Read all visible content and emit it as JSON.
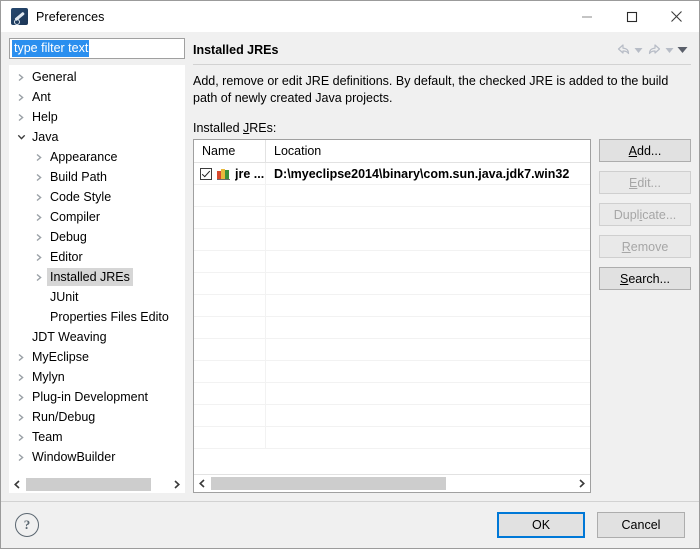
{
  "window": {
    "title": "Preferences",
    "icon": "preferences-wrench-icon",
    "minimize_label": "—",
    "maximize_label": "□",
    "close_label": "✕"
  },
  "filter": {
    "value": "type filter text",
    "placeholder": "type filter text"
  },
  "tree": {
    "items": [
      {
        "label": "General",
        "level": 0,
        "arrow": "collapsed",
        "selected": false
      },
      {
        "label": "Ant",
        "level": 0,
        "arrow": "collapsed",
        "selected": false
      },
      {
        "label": "Help",
        "level": 0,
        "arrow": "collapsed",
        "selected": false
      },
      {
        "label": "Java",
        "level": 0,
        "arrow": "expanded",
        "selected": false
      },
      {
        "label": "Appearance",
        "level": 1,
        "arrow": "collapsed",
        "selected": false
      },
      {
        "label": "Build Path",
        "level": 1,
        "arrow": "collapsed",
        "selected": false
      },
      {
        "label": "Code Style",
        "level": 1,
        "arrow": "collapsed",
        "selected": false
      },
      {
        "label": "Compiler",
        "level": 1,
        "arrow": "collapsed",
        "selected": false
      },
      {
        "label": "Debug",
        "level": 1,
        "arrow": "collapsed",
        "selected": false
      },
      {
        "label": "Editor",
        "level": 1,
        "arrow": "collapsed",
        "selected": false
      },
      {
        "label": "Installed JREs",
        "level": 1,
        "arrow": "collapsed",
        "selected": true
      },
      {
        "label": "JUnit",
        "level": 1,
        "arrow": "none",
        "selected": false
      },
      {
        "label": "Properties Files Edito",
        "level": 1,
        "arrow": "none",
        "selected": false
      },
      {
        "label": "JDT Weaving",
        "level": 0,
        "arrow": "none",
        "selected": false
      },
      {
        "label": "MyEclipse",
        "level": 0,
        "arrow": "collapsed",
        "selected": false
      },
      {
        "label": "Mylyn",
        "level": 0,
        "arrow": "collapsed",
        "selected": false
      },
      {
        "label": "Plug-in Development",
        "level": 0,
        "arrow": "collapsed",
        "selected": false
      },
      {
        "label": "Run/Debug",
        "level": 0,
        "arrow": "collapsed",
        "selected": false
      },
      {
        "label": "Team",
        "level": 0,
        "arrow": "collapsed",
        "selected": false
      },
      {
        "label": "WindowBuilder",
        "level": 0,
        "arrow": "collapsed",
        "selected": false
      }
    ]
  },
  "page": {
    "title": "Installed JREs",
    "description": "Add, remove or edit JRE definitions. By default, the checked JRE is added to the build path of newly created Java projects.",
    "list_label_pre": "Installed ",
    "list_label_mnemonic": "J",
    "list_label_post": "REs:",
    "header_tools": [
      {
        "name": "back-arrow-icon",
        "state": "disabled"
      },
      {
        "name": "back-dropdown-icon",
        "state": "disabled"
      },
      {
        "name": "forward-arrow-icon",
        "state": "disabled"
      },
      {
        "name": "forward-dropdown-icon",
        "state": "disabled"
      },
      {
        "name": "view-menu-dropdown-icon",
        "state": "enabled"
      }
    ]
  },
  "table": {
    "columns": [
      {
        "key": "name",
        "header": "Name"
      },
      {
        "key": "location",
        "header": "Location"
      }
    ],
    "rows": [
      {
        "checked": true,
        "icon": "jre-library-icon",
        "name": "jre ...",
        "location": "D:\\myeclipse2014\\binary\\com.sun.java.jdk7.win32"
      }
    ],
    "empty_row_count": 12
  },
  "side_buttons": [
    {
      "label": "Add...",
      "mnemonic": "A",
      "enabled": true
    },
    {
      "label": "Edit...",
      "mnemonic": "E",
      "enabled": false
    },
    {
      "label": "Duplicate...",
      "mnemonic": "i",
      "enabled": false
    },
    {
      "label": "Remove",
      "mnemonic": "R",
      "enabled": false
    },
    {
      "label": "Search...",
      "mnemonic": "S",
      "enabled": true
    }
  ],
  "scrollbars": {
    "tree": {
      "left_arrow": "‹",
      "right_arrow": "›",
      "thumb_percent": 88
    },
    "table": {
      "left_arrow": "‹",
      "right_arrow": "›",
      "thumb_percent": 65
    }
  },
  "footer": {
    "help_label": "?",
    "ok_label": "OK",
    "cancel_label": "Cancel"
  },
  "colors": {
    "dialog_bg": "#f0f0f0",
    "selection_blue": "#2a8fef",
    "default_button_border": "#0078d7",
    "tree_selection_gray": "#d6d6d6"
  }
}
